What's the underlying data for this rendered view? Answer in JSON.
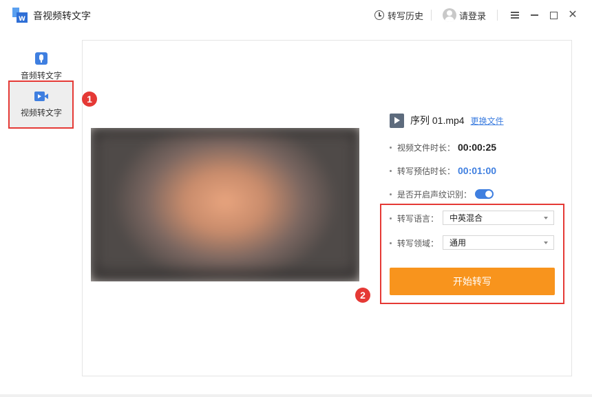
{
  "app": {
    "title": "音视频转文字",
    "logo_icon": "app-logo-icon"
  },
  "header": {
    "history_label": "转写历史",
    "login_label": "请登录"
  },
  "sidebar": {
    "items": [
      {
        "label": "音频转文字",
        "icon": "microphone-icon",
        "selected": false
      },
      {
        "label": "视频转文字",
        "icon": "video-camera-icon",
        "selected": true
      }
    ]
  },
  "annotations": {
    "marker_1": "1",
    "marker_2": "2",
    "highlight_color": "#e53935"
  },
  "file": {
    "name": "序列 01.mp4",
    "change_link": "更换文件"
  },
  "info": {
    "duration_label": "视频文件时长：",
    "duration_value": "00:00:25",
    "estimate_label": "转写预估时长：",
    "estimate_value": "00:01:00",
    "voiceprint_label": "是否开启声纹识别：",
    "voiceprint_enabled": true,
    "language_label": "转写语言：",
    "language_value": "中英混合",
    "domain_label": "转写领域：",
    "domain_value": "通用"
  },
  "actions": {
    "start_label": "开始转写"
  },
  "colors": {
    "accent_blue": "#3f7fe0",
    "start_orange": "#f8941d",
    "sidebar_selected_bg": "#eeeeee"
  }
}
